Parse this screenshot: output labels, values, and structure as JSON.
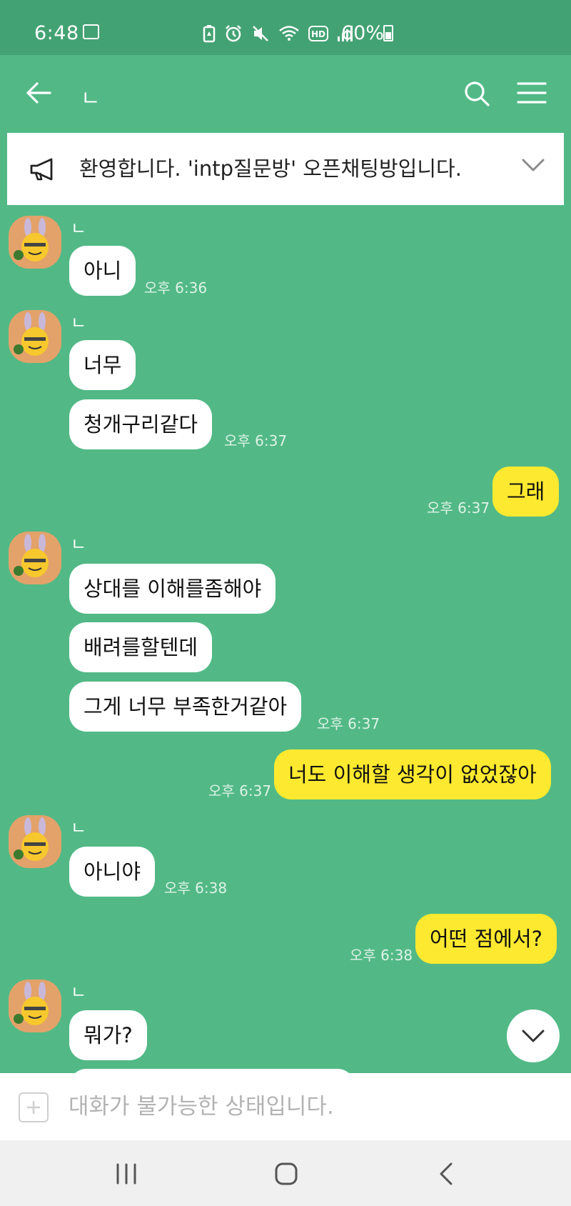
{
  "status_bar": {
    "time": "6:48",
    "battery_percent": "60%",
    "icons": [
      "gallery-icon",
      "battery-saver-icon",
      "alarm-icon",
      "mute-icon",
      "wifi-icon",
      "hd-icon",
      "signal-icon",
      "battery-icon"
    ]
  },
  "header": {
    "title": "ㄴ",
    "back_icon": "arrow-left-icon",
    "search_icon": "search-icon",
    "menu_icon": "hamburger-menu-icon"
  },
  "notice": {
    "text": "환영합니다. 'intp질문방' 오픈채팅방입니다.",
    "icon": "megaphone-icon"
  },
  "messages": [
    {
      "side": "in",
      "sender": "ㄴ",
      "texts": [
        "아니"
      ],
      "time": "오후 6:36"
    },
    {
      "side": "in",
      "sender": "ㄴ",
      "texts": [
        "너무",
        "청개구리같다"
      ],
      "time": "오후 6:37"
    },
    {
      "side": "out",
      "texts": [
        "그래"
      ],
      "time": "오후 6:37"
    },
    {
      "side": "in",
      "sender": "ㄴ",
      "texts": [
        "상대를 이해를좀해야",
        "배려를할텐데",
        "그게 너무 부족한거같아"
      ],
      "time": "오후 6:37"
    },
    {
      "side": "out",
      "texts": [
        "너도 이해할 생각이 없었잖아"
      ],
      "time": "오후 6:37"
    },
    {
      "side": "in",
      "sender": "ㄴ",
      "texts": [
        "아니야"
      ],
      "time": "오후 6:38"
    },
    {
      "side": "out",
      "texts": [
        "어떤 점에서?"
      ],
      "time": "오후 6:38"
    },
    {
      "side": "in",
      "sender": "ㄴ",
      "texts": [
        "뭐가?"
      ],
      "time": ""
    }
  ],
  "input": {
    "placeholder": "대화가 불가능한 상태입니다."
  },
  "colors": {
    "chat_background": "#52b986",
    "status_bar": "#43a273",
    "incoming_bubble": "#ffffff",
    "outgoing_bubble": "#fde92f"
  }
}
